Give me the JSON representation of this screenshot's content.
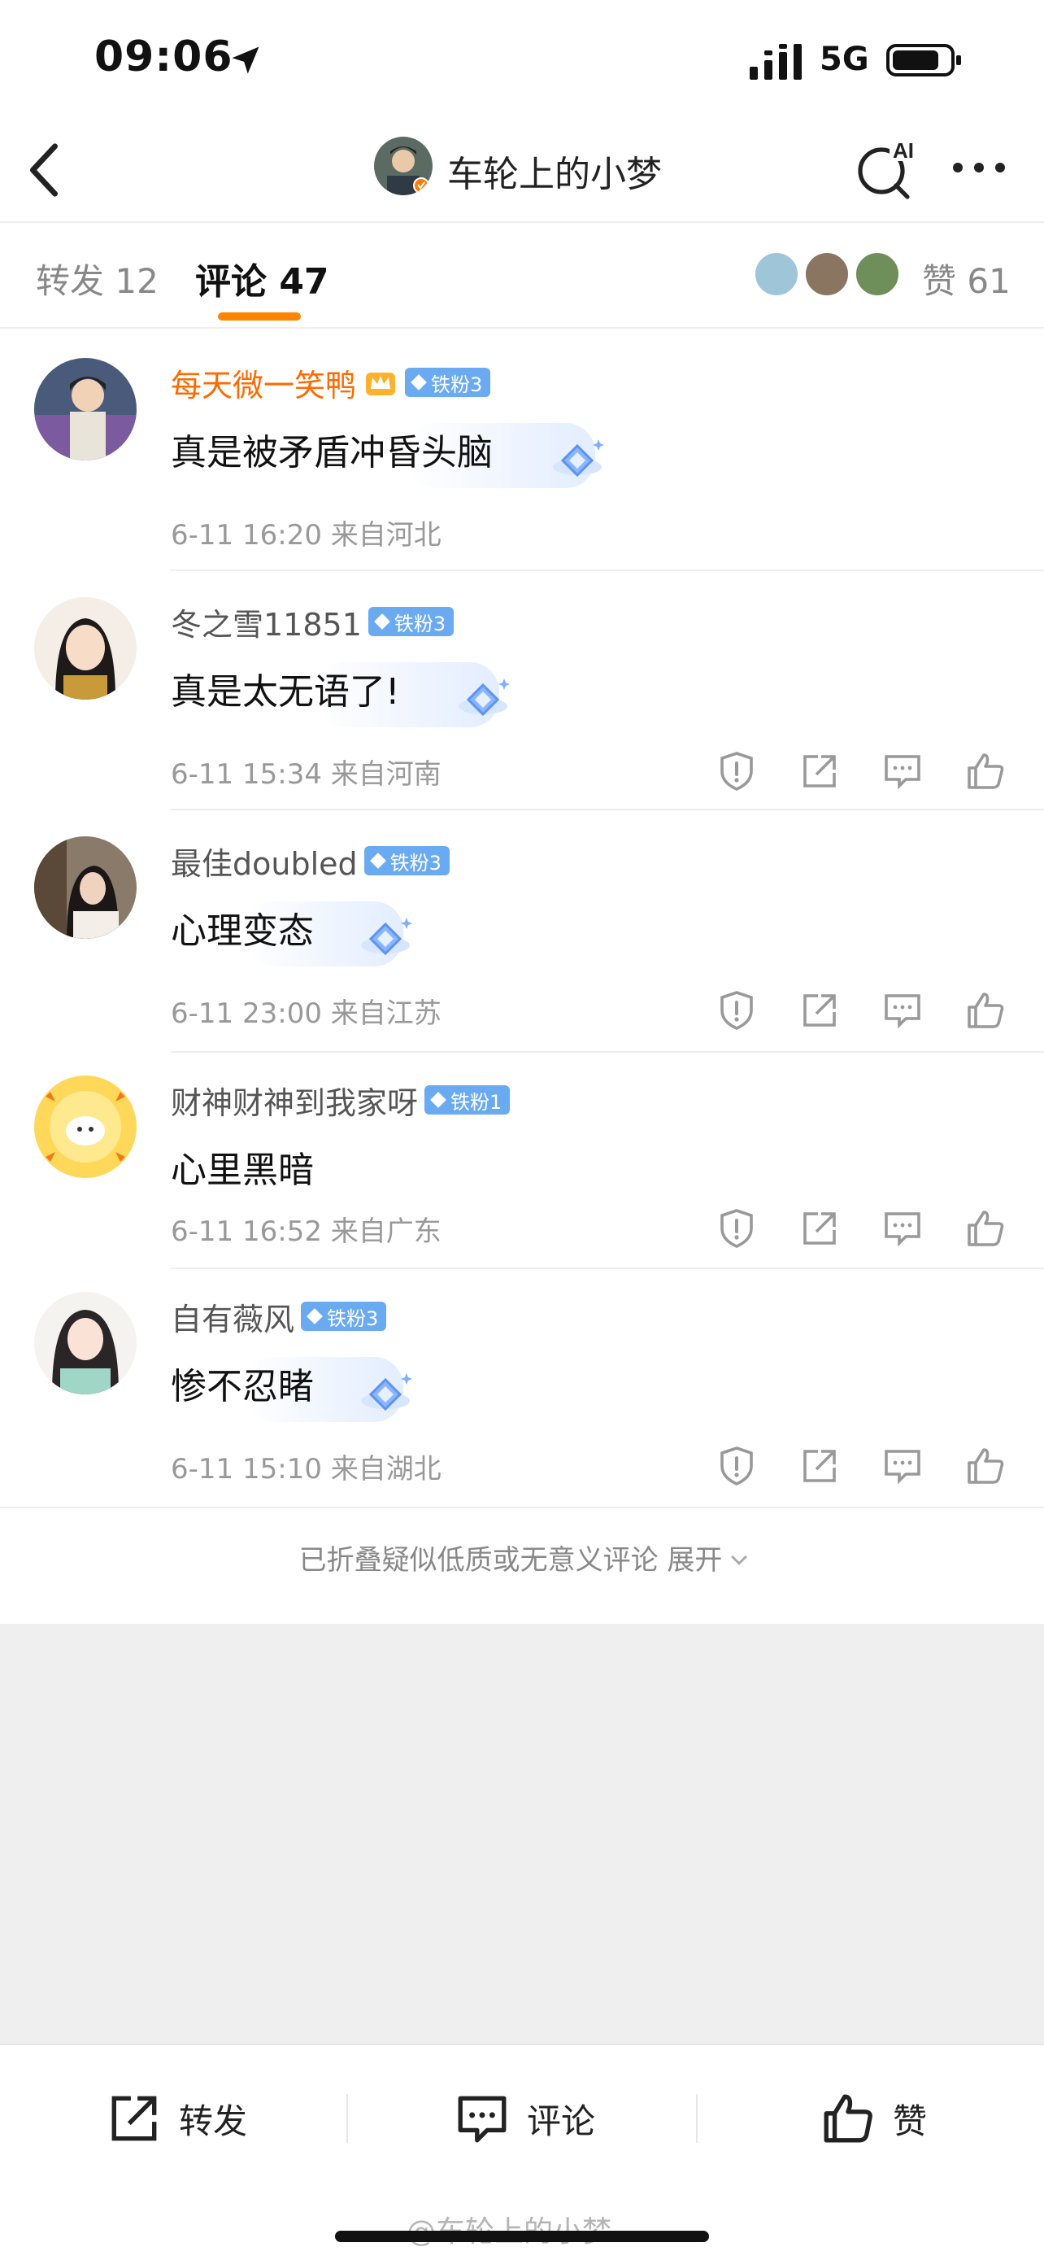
{
  "status_bar": {
    "time": "09:06",
    "network": "5G"
  },
  "nav": {
    "title": "车轮上的小梦"
  },
  "tabs": {
    "repost_label": "转发 12",
    "comments_label": "评论 47",
    "likes_label": "赞 61"
  },
  "comments": [
    {
      "user": "每天微一笑鸭",
      "badge": "铁粉3",
      "text": "真是被矛盾冲昏头脑",
      "meta": "6-11 16:20  来自河北",
      "vip": true
    },
    {
      "user": "冬之雪11851",
      "badge": "铁粉3",
      "text": "真是太无语了!",
      "meta": "6-11 15:34  来自河南"
    },
    {
      "user": "最佳doubled",
      "badge": "铁粉3",
      "text": "心理变态",
      "meta": "6-11 23:00  来自江苏"
    },
    {
      "user": "财神财神到我家呀",
      "badge": "铁粉1",
      "text": "心里黑暗",
      "meta": "6-11 16:52  来自广东"
    },
    {
      "user": "自有薇风",
      "badge": "铁粉3",
      "text": "惨不忍睹",
      "meta": "6-11 15:10  来自湖北"
    }
  ],
  "folded_notice": "已折叠疑似低质或无意义评论 展开",
  "bottom_bar": {
    "repost": "转发",
    "comment": "评论",
    "like": "赞"
  },
  "watermark": "@车轮上的小梦",
  "colors": {
    "accent": "#ff8200",
    "vip_name": "#ff6a00",
    "fan_badge": "#6aaaf0"
  },
  "icons": [
    "location-arrow-icon",
    "signal-icon",
    "battery-icon",
    "back-icon",
    "ai-search-icon",
    "more-icon",
    "diamond-icon",
    "report-icon",
    "share-icon",
    "reply-icon",
    "like-icon",
    "crown-icon"
  ]
}
